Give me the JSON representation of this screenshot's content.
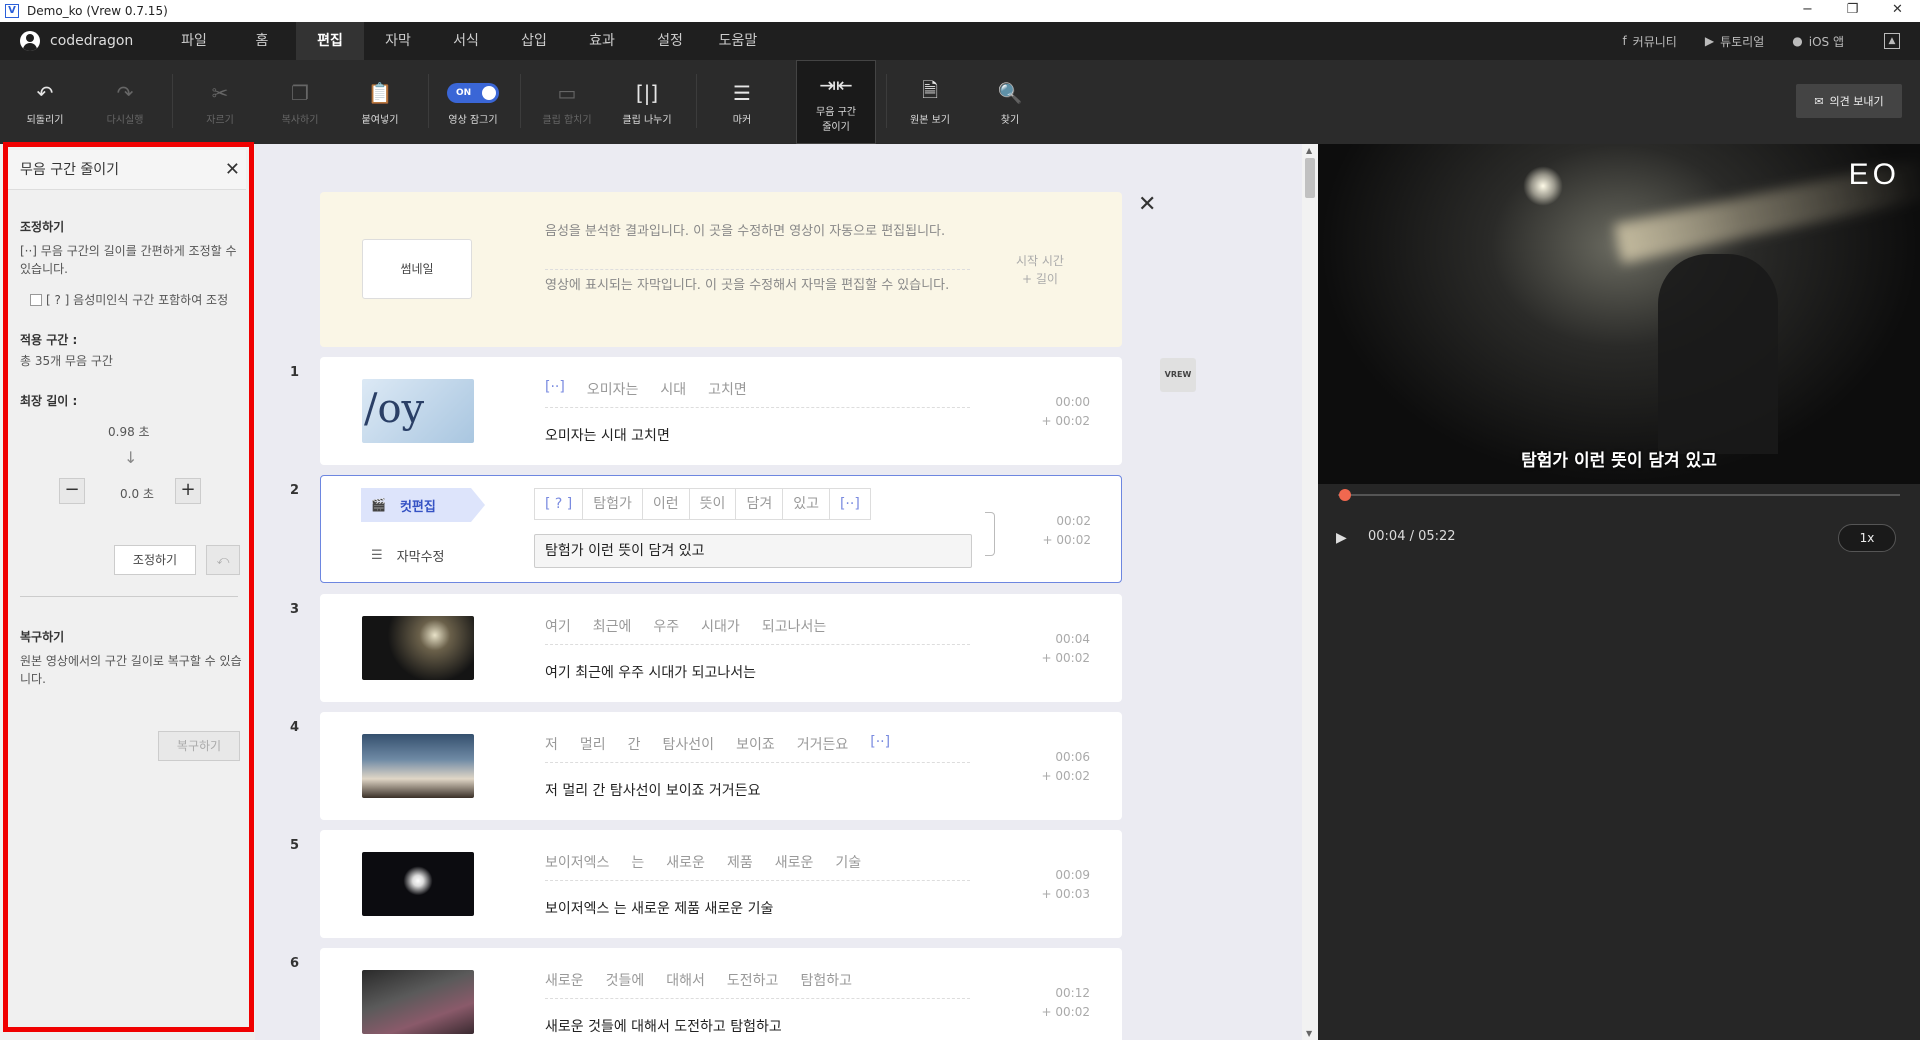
{
  "window": {
    "title": "Demo_ko (Vrew 0.7.15)",
    "icon_letter": "V",
    "controls": [
      "−",
      "❐",
      "✕"
    ]
  },
  "menubar": {
    "user": "codedragon",
    "items": [
      "파일",
      "홈",
      "편집",
      "자막",
      "서식",
      "삽입",
      "효과",
      "설정",
      "도움말"
    ],
    "active": "편집",
    "links": [
      "커뮤니티",
      "튜토리얼",
      "iOS 앱"
    ]
  },
  "toolbar": {
    "buttons": [
      {
        "label": "되돌리기",
        "icon": "undo-icon",
        "enabled": true
      },
      {
        "label": "다시실행",
        "icon": "redo-icon",
        "enabled": false
      },
      {
        "label": "자르기",
        "icon": "scissors-icon",
        "enabled": false
      },
      {
        "label": "복사하기",
        "icon": "copy-icon",
        "enabled": false
      },
      {
        "label": "붙여넣기",
        "icon": "paste-icon",
        "enabled": true
      },
      {
        "label": "영상 잠그기",
        "icon": "toggle-switch",
        "enabled": true,
        "toggle_text": "ON"
      },
      {
        "label": "클립 합치기",
        "icon": "merge-clip-icon",
        "enabled": false
      },
      {
        "label": "클립 나누기",
        "icon": "split-clip-icon",
        "enabled": true
      },
      {
        "label": "마커",
        "icon": "marker-icon",
        "enabled": true
      },
      {
        "label": "무음 구간 줄이기",
        "icon": "shrink-silence-icon",
        "enabled": true,
        "selected": true
      },
      {
        "label": "원본 보기",
        "icon": "source-view-icon",
        "enabled": true
      },
      {
        "label": "찾기",
        "icon": "find-icon",
        "enabled": true
      }
    ],
    "feedback": "의견 보내기"
  },
  "left_panel": {
    "title": "무음 구간 줄이기",
    "adjust_heading": "조정하기",
    "adjust_desc": "[··] 무음 구간의 길이를 간편하게 조정할 수 있습니다.",
    "checkbox_label": "[ ? ] 음성미인식 구간 포함하여 조정",
    "checkbox_checked": false,
    "apply_heading": "적용 구간 :",
    "apply_value": "총 35개 무음 구간",
    "max_heading": "최장 길이 :",
    "from_value": "0.98 초",
    "arrow": "↓",
    "to_value": "0.0 초",
    "minus": "−",
    "plus": "+",
    "adjust_button": "조정하기",
    "undo_symbol": "⤺",
    "restore_heading": "복구하기",
    "restore_desc": "원본 영상에서의 구간 길이로 복구할 수 있습니다.",
    "restore_button": "복구하기"
  },
  "header_card": {
    "thumb_label": "썸네일",
    "line1": "음성을 분석한 결과입니다. 이 곳을 수정하면 영상이 자동으로 편집됩니다.",
    "line2": "영상에 표시되는 자막입니다. 이 곳을 수정해서 자막을 편집할 수 있습니다.",
    "time_label": "시작 시간",
    "len_label": "+ 길이"
  },
  "clips": [
    {
      "num": "1",
      "words": [
        "[··]",
        "오미자는",
        "시대",
        "고치면"
      ],
      "subtitle": "오미자는 시대 고치면",
      "start": "00:00",
      "length": "+ 00:02",
      "thumb_text": "/oy"
    },
    {
      "num": "2",
      "words": [
        "[ ? ]",
        "탐험가",
        "이런",
        "뜻이",
        "담겨",
        "있고",
        "[··]"
      ],
      "subtitle": "탐험가 이런 뜻이 담겨 있고",
      "start": "00:02",
      "length": "+ 00:02",
      "selected": true,
      "edit_label": "컷편집",
      "subtitle_edit_label": "자막수정"
    },
    {
      "num": "3",
      "words": [
        "여기",
        "최근에",
        "우주",
        "시대가",
        "되고나서는"
      ],
      "subtitle": "여기 최근에 우주 시대가 되고나서는",
      "start": "00:04",
      "length": "+ 00:02"
    },
    {
      "num": "4",
      "words": [
        "저",
        "멀리",
        "간",
        "탐사선이",
        "보이죠",
        "거거든요",
        "[··]"
      ],
      "subtitle": "저 멀리 간 탐사선이 보이죠 거거든요",
      "start": "00:06",
      "length": "+ 00:02"
    },
    {
      "num": "5",
      "words": [
        "보이저엑스",
        "는",
        "새로운",
        "제품",
        "새로운",
        "기술"
      ],
      "subtitle": "보이저엑스 는 새로운 제품 새로운 기술",
      "start": "00:09",
      "length": "+ 00:03"
    },
    {
      "num": "6",
      "words": [
        "새로운",
        "것들에",
        "대해서",
        "도전하고",
        "탐험하고"
      ],
      "subtitle": "새로운 것들에 대해서 도전하고 탐험하고",
      "start": "00:12",
      "length": "+ 00:02"
    }
  ],
  "vrew_badge": "VREW",
  "player": {
    "logo": "EO",
    "caption": "탐험가 이런 뜻이 담겨 있고",
    "time": "00:04 / 05:22",
    "speed": "1x",
    "progress_fraction": 0.0125
  },
  "colors": {
    "accent": "#3a66d6",
    "highlight_border": "#f00000",
    "progress_dot": "#f0684f"
  }
}
